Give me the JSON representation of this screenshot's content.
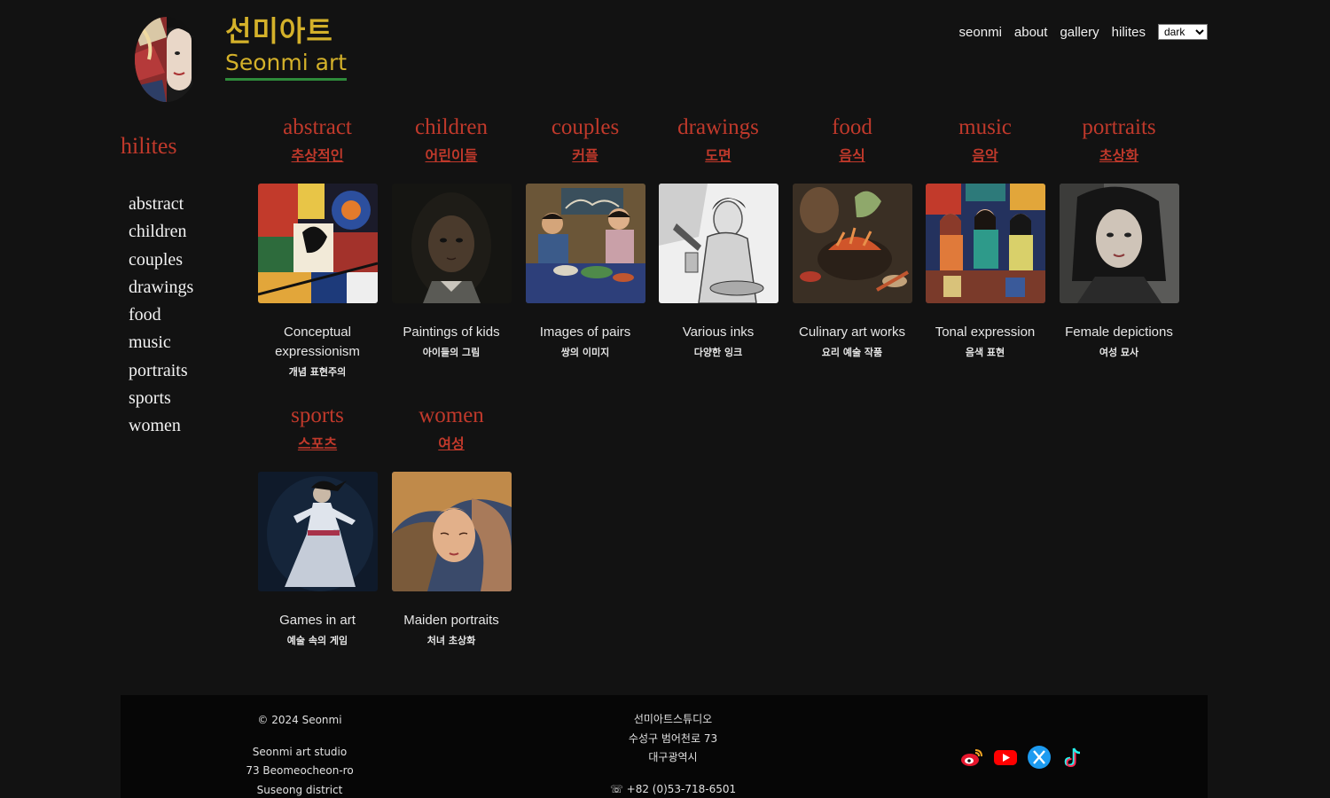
{
  "brand": {
    "name_ko": "선미아트",
    "name_en": "Seonmi art"
  },
  "nav": {
    "links": [
      "seonmi",
      "about",
      "gallery",
      "hilites"
    ],
    "theme_selected": "dark"
  },
  "sidebar": {
    "title": "hilites",
    "items": [
      "abstract",
      "children",
      "couples",
      "drawings",
      "food",
      "music",
      "portraits",
      "sports",
      "women"
    ]
  },
  "gallery": [
    {
      "en": "abstract",
      "ko": "추상적인",
      "desc": "Conceptual expressionism",
      "desc_ko": "개념 표현주의"
    },
    {
      "en": "children",
      "ko": "어린이들",
      "desc": "Paintings of kids",
      "desc_ko": "아이들의 그림"
    },
    {
      "en": "couples",
      "ko": "커플",
      "desc": "Images of pairs",
      "desc_ko": "쌍의 이미지"
    },
    {
      "en": "drawings",
      "ko": "도면",
      "desc": "Various inks",
      "desc_ko": "다양한 잉크"
    },
    {
      "en": "food",
      "ko": "음식",
      "desc": "Culinary art works",
      "desc_ko": "요리 예술 작품"
    },
    {
      "en": "music",
      "ko": "음악",
      "desc": "Tonal expression",
      "desc_ko": "음색 표현"
    },
    {
      "en": "portraits",
      "ko": "초상화",
      "desc": "Female depictions",
      "desc_ko": "여성 묘사"
    },
    {
      "en": "sports",
      "ko": "스포츠",
      "desc": "Games in art",
      "desc_ko": "예술 속의 게임"
    },
    {
      "en": "women",
      "ko": "여성",
      "desc": "Maiden portraits",
      "desc_ko": "처녀 초상화"
    }
  ],
  "footer": {
    "copyright": "© 2024 Seonmi",
    "studio_en": "Seonmi art studio",
    "address1_en": "73 Beomeocheon-ro",
    "address2_en": "Suseong district",
    "studio_ko": "선미아트스튜디오",
    "address1_ko": "수성구 범어천로 73",
    "address2_ko": "대구광역시",
    "phone": "☏ +82 (0)53-718-6501",
    "social_icons": [
      "weibo-icon",
      "youtube-icon",
      "x-icon",
      "tiktok-icon"
    ]
  },
  "colors": {
    "background": "#121212",
    "accent_red": "#c0392b",
    "brand_gold": "#d4b12a",
    "brand_underline": "#2e8b3a"
  }
}
